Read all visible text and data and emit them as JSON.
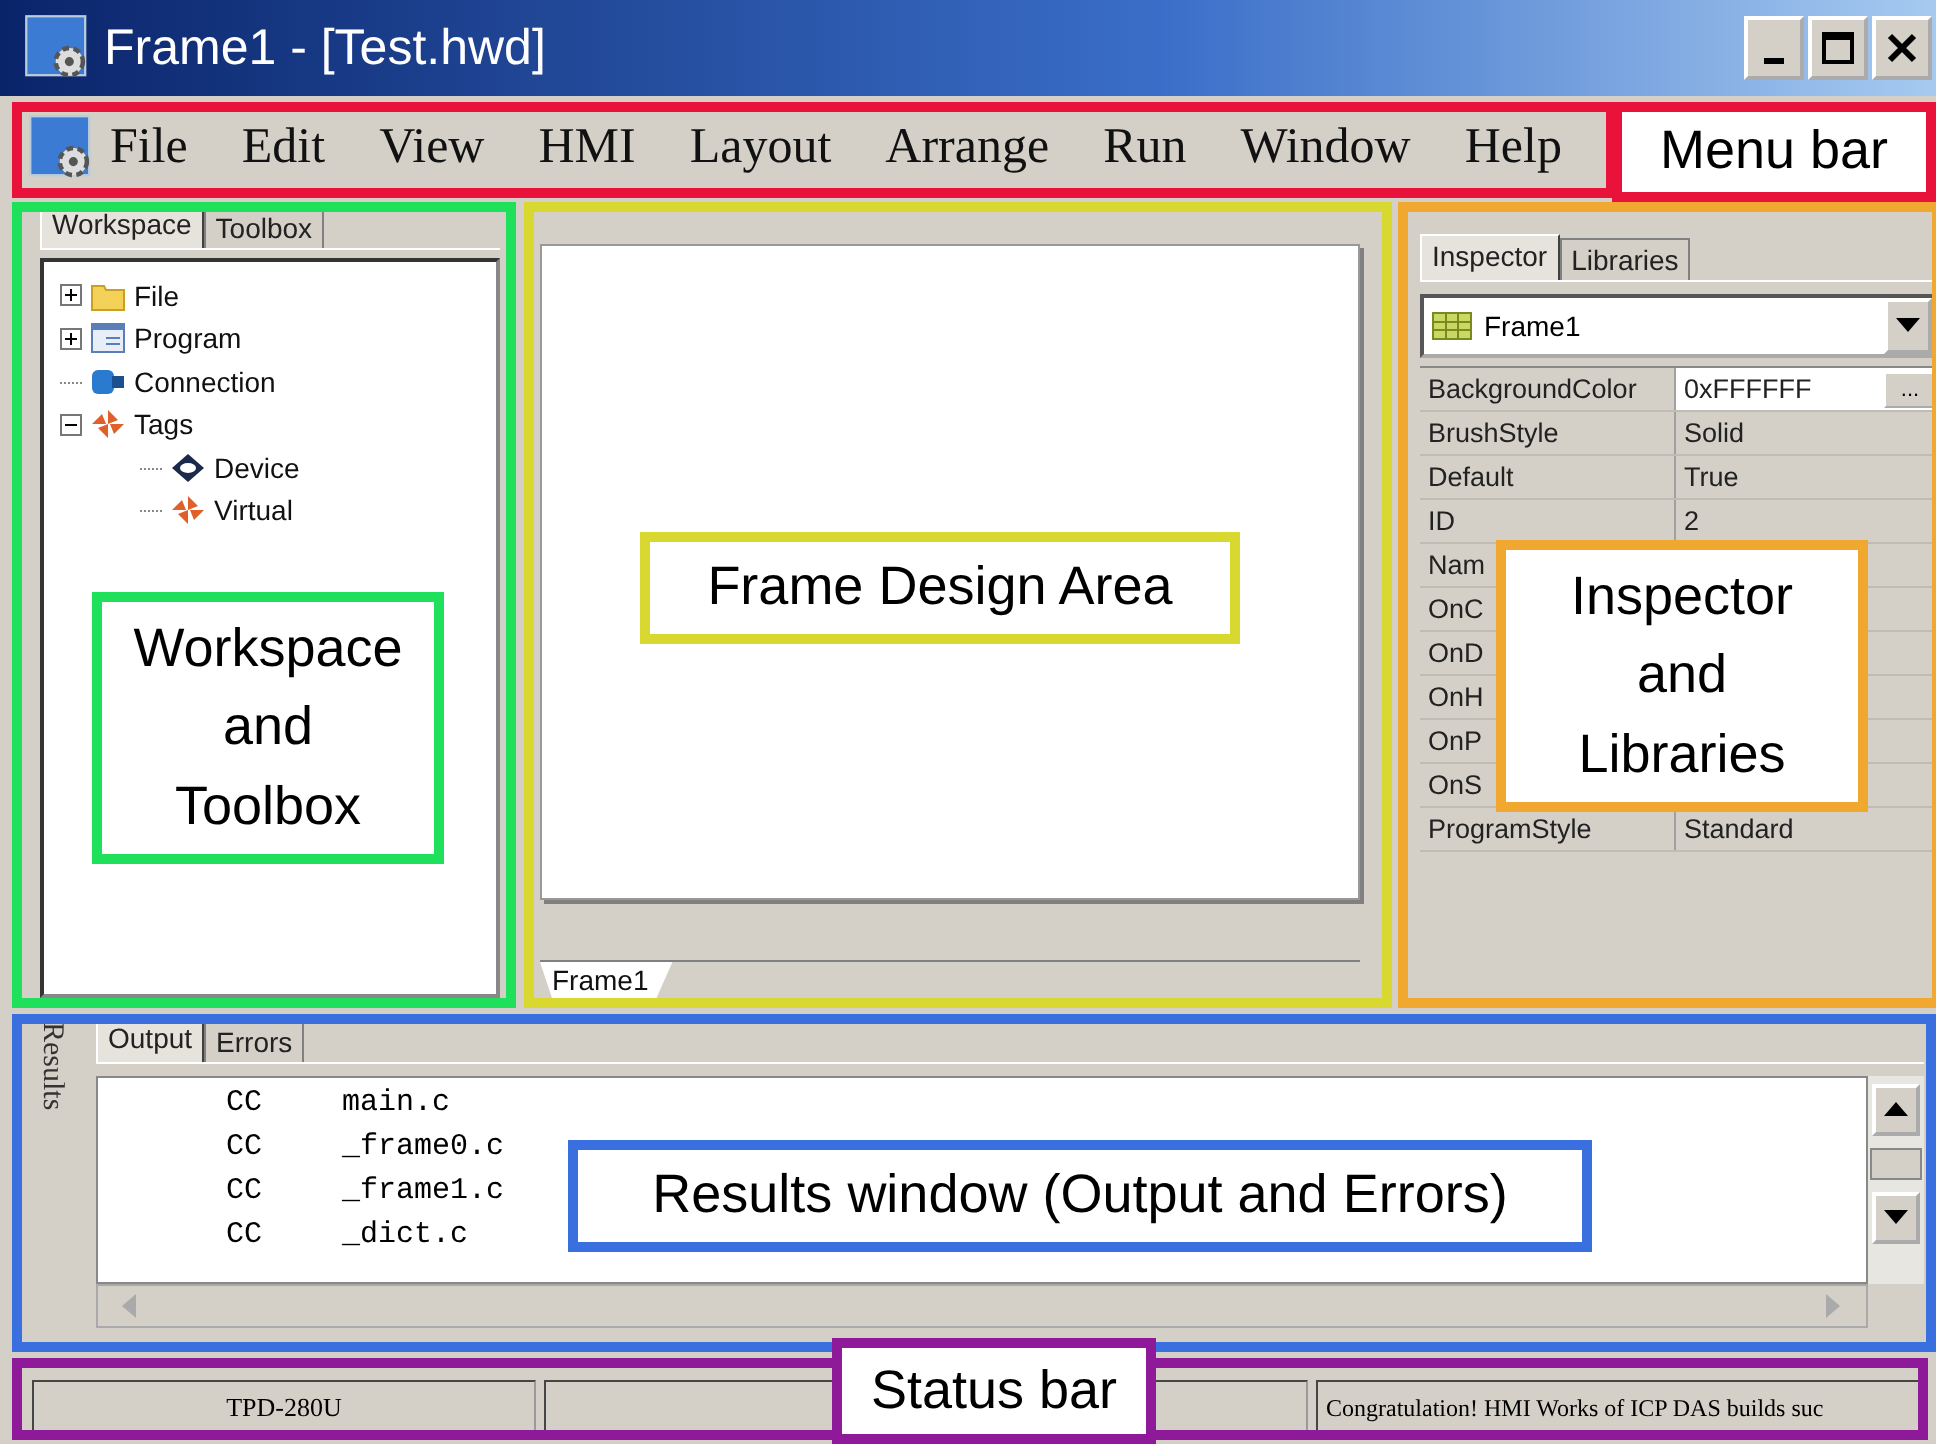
{
  "window": {
    "title": "Frame1 - [Test.hwd]"
  },
  "menu_bar": {
    "items": [
      "File",
      "Edit",
      "View",
      "HMI",
      "Layout",
      "Arrange",
      "Run",
      "Window",
      "Help"
    ]
  },
  "workspace": {
    "tabs": [
      {
        "label": "Workspace",
        "selected": true
      },
      {
        "label": "Toolbox",
        "selected": false
      }
    ],
    "tree": [
      {
        "label": "File",
        "kind": "folder",
        "expanded": false
      },
      {
        "label": "Program",
        "kind": "program",
        "expanded": false
      },
      {
        "label": "Connection",
        "kind": "connection"
      },
      {
        "label": "Tags",
        "kind": "tag",
        "expanded": true,
        "children": [
          {
            "label": "Device",
            "kind": "device"
          },
          {
            "label": "Virtual",
            "kind": "tag"
          }
        ]
      }
    ]
  },
  "design": {
    "tabs": [
      {
        "label": "Frame1",
        "selected": true
      }
    ]
  },
  "inspector": {
    "tabs": [
      {
        "label": "Inspector",
        "selected": true
      },
      {
        "label": "Libraries",
        "selected": false
      }
    ],
    "object": "Frame1",
    "properties": [
      {
        "name": "BackgroundColor",
        "value": "0xFFFFFF",
        "button": "...",
        "selected": true
      },
      {
        "name": "BrushStyle",
        "value": "Solid",
        "selected": false
      },
      {
        "name": "Default",
        "value": "True",
        "selected": false
      },
      {
        "name": "ID",
        "value": "2",
        "selected": false
      },
      {
        "name": "Nam",
        "selected": false
      },
      {
        "name": "OnC",
        "selected": false
      },
      {
        "name": "OnD",
        "selected": false
      },
      {
        "name": "OnH",
        "selected": false
      },
      {
        "name": "OnP",
        "selected": false
      },
      {
        "name": "OnS",
        "selected": false
      },
      {
        "name": "ProgramStyle",
        "value": "Standard",
        "selected": false
      }
    ]
  },
  "results": {
    "side_label": "Results",
    "tabs": [
      {
        "label": "Output",
        "selected": true
      },
      {
        "label": "Errors",
        "selected": false
      }
    ],
    "lines": [
      {
        "tool": "CC",
        "file": "main.c"
      },
      {
        "tool": "CC",
        "file": "_frame0.c"
      },
      {
        "tool": "CC",
        "file": "_frame1.c"
      },
      {
        "tool": "CC",
        "file": "_dict.c"
      }
    ]
  },
  "status_bar": {
    "device": "TPD-280U",
    "message": "Congratulation! HMI Works of ICP DAS builds suc"
  },
  "annotations": [
    {
      "text": "Menu bar",
      "color": "#e8123a"
    },
    {
      "text": "Workspace and Toolbox",
      "color": "#1ee05a"
    },
    {
      "text": "Frame Design Area",
      "color": "#d8d830"
    },
    {
      "text": "Inspector and Libraries",
      "color": "#f0a830"
    },
    {
      "text": "Results window (Output and Errors)",
      "color": "#3a6fe0"
    },
    {
      "text": "Status bar",
      "color": "#8e1a9a"
    }
  ]
}
